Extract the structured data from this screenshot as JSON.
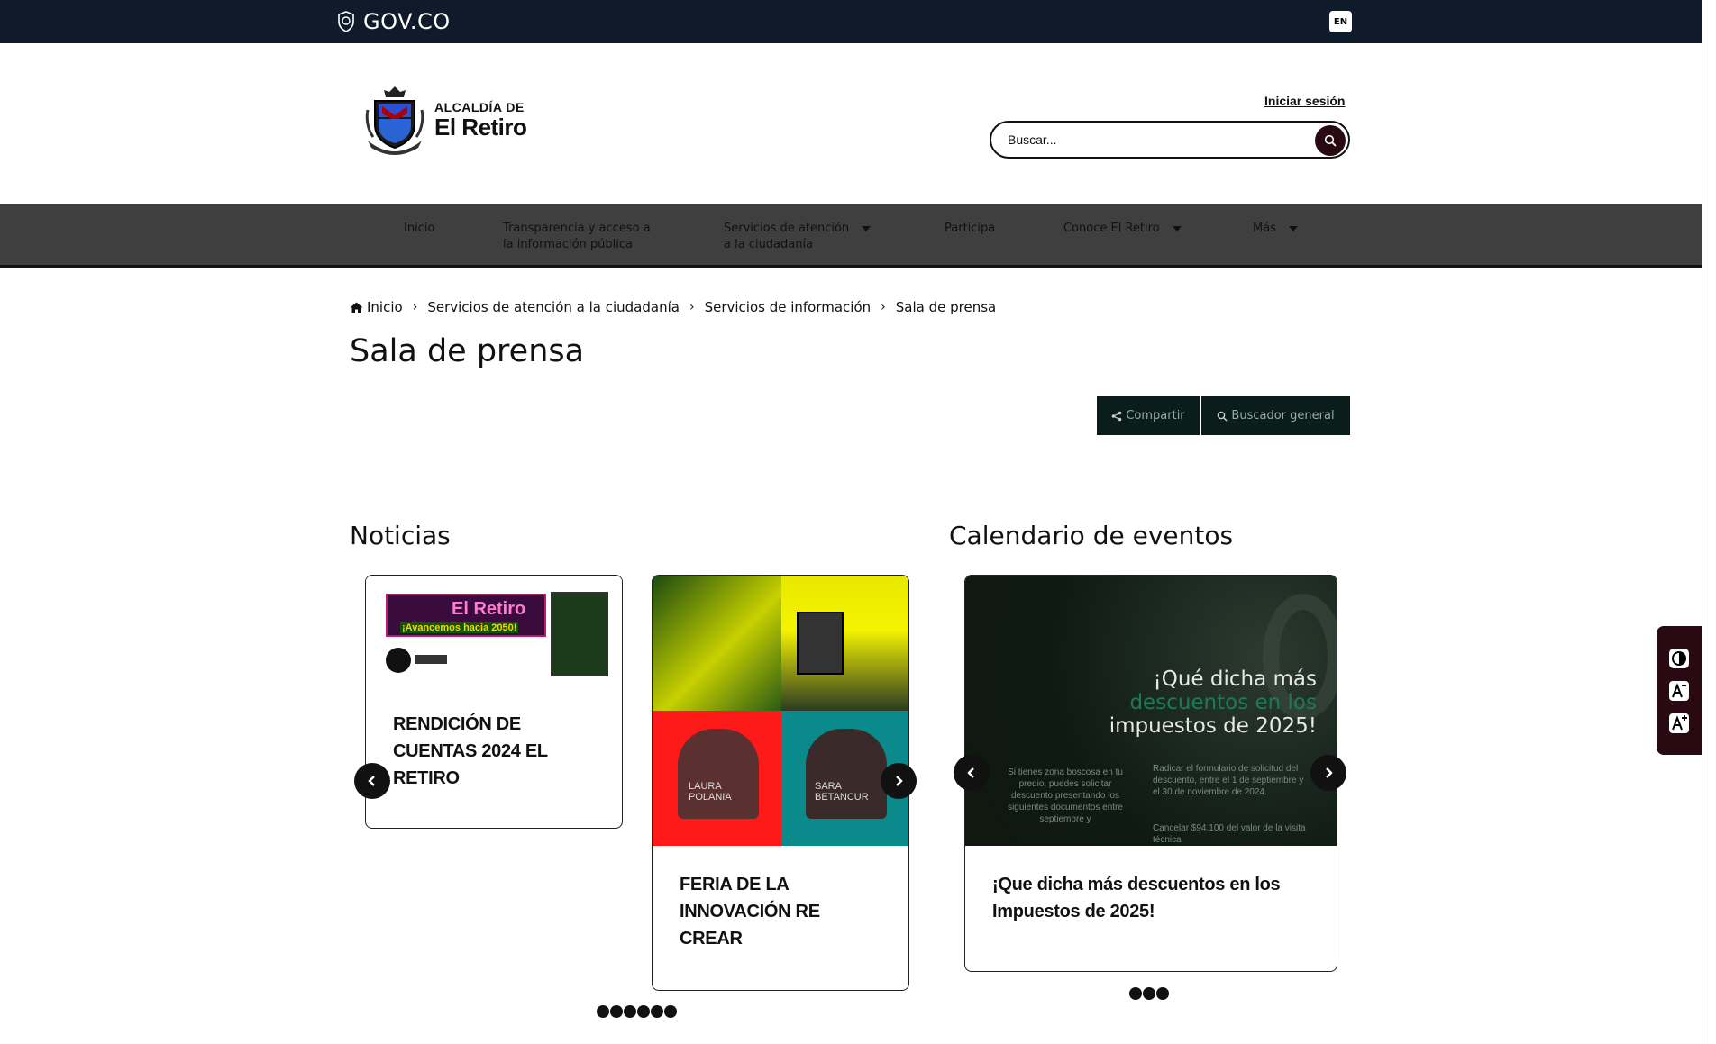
{
  "gov_bar": {
    "logo_text": "GOV.CO",
    "lang_button": "EN"
  },
  "header": {
    "brand_sub": "ALCALDÍA DE",
    "brand_main": "El Retiro",
    "login_link": "Iniciar sesión",
    "search_placeholder": "Buscar..."
  },
  "nav": {
    "items": [
      {
        "line1": "Inicio",
        "line2": ""
      },
      {
        "line1": "Transparencia y acceso a",
        "line2": "la información pública"
      },
      {
        "line1": "Servicios de atención",
        "line2": "a la ciudadanía"
      },
      {
        "line1": "Participa",
        "line2": ""
      },
      {
        "line1": "Conoce El Retiro",
        "line2": ""
      },
      {
        "line1": "Más",
        "line2": ""
      }
    ]
  },
  "breadcrumb": {
    "items": [
      "Inicio",
      "Servicios de atención a la ciudadanía",
      "Servicios de información",
      "Sala de prensa"
    ]
  },
  "page_title": "Sala de prensa",
  "toolbar": {
    "share_label": "Compartir",
    "search_label": "Buscador general"
  },
  "noticias": {
    "title": "Noticias",
    "cards": [
      {
        "title_lines": [
          "RENDICIÓN DE",
          "CUENTAS 2024 EL",
          "RETIRO"
        ],
        "image_text_brand": "El Retiro",
        "image_text_slogan": "¡Avancemos hacia 2050!"
      },
      {
        "title_lines": [
          "FERIA DE LA",
          "INNOVACIÓN RE",
          "CREAR"
        ],
        "image_names": [
          "LAURA POLANIA",
          "SARA BETANCUR"
        ]
      }
    ],
    "dot_count": 6
  },
  "calendario": {
    "title": "Calendario de eventos",
    "card": {
      "title_lines": [
        "¡Que dicha más descuentos en los",
        "Impuestos de 2025!"
      ],
      "image_headline_1": "¡Qué dicha más",
      "image_headline_2": "descuentos en los",
      "image_headline_3": "impuestos de 2025!",
      "image_left_text": "Si tienes zona boscosa en tu predio, puedes solicitar descuento presentando los siguientes documentos entre septiembre y",
      "image_right_text": "Radicar el formulario de solicitud del descuento, entre el 1 de septiembre y el 30 de noviembre de 2024.",
      "image_right_text_2": "Cancelar $94.100 del valor de la visita técnica"
    },
    "dot_count": 3
  },
  "colors": {
    "gov_bar": "#0f1a2b",
    "nav": "#3f3f3f",
    "button_dark": "#0b1d1b",
    "accent": "#2a0a12"
  }
}
